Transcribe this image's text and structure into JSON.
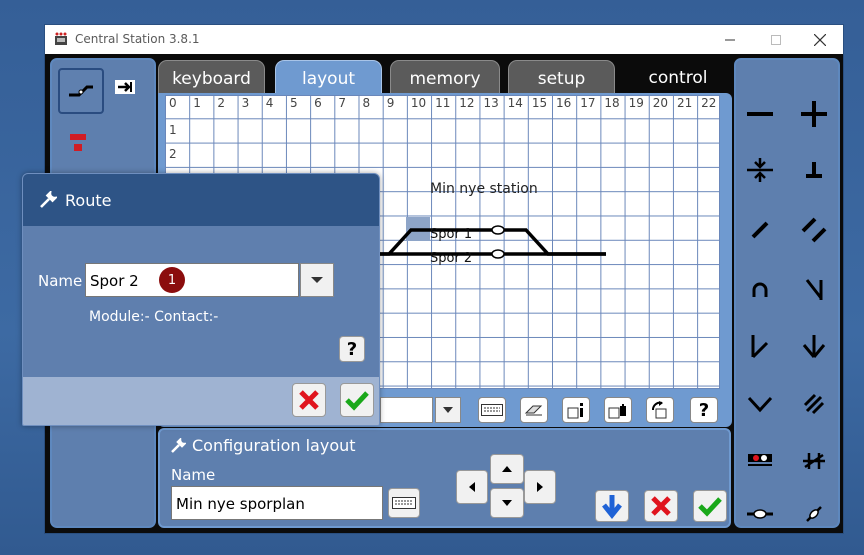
{
  "window": {
    "title": "Central Station 3.8.1"
  },
  "tabs": [
    {
      "label": "keyboard",
      "active": false
    },
    {
      "label": "layout",
      "active": true
    },
    {
      "label": "memory",
      "active": false
    },
    {
      "label": "setup",
      "active": false
    },
    {
      "label": "control",
      "active": false
    }
  ],
  "grid": {
    "columns": [
      "0",
      "1",
      "2",
      "3",
      "4",
      "5",
      "6",
      "7",
      "8",
      "9",
      "10",
      "11",
      "12",
      "13",
      "14",
      "15",
      "16",
      "17",
      "18",
      "19",
      "20",
      "21",
      "22"
    ],
    "rows": [
      "1",
      "2"
    ],
    "station_label": "Min nye station",
    "tracks": [
      "Spor 1",
      "Spor 2"
    ]
  },
  "config": {
    "title": "Configuration layout",
    "name_label": "Name",
    "name_value": "Min nye sporplan"
  },
  "route_dialog": {
    "title": "Route",
    "name_label": "Name",
    "name_value": "Spor 2",
    "badge": "1",
    "module_contact": "Module:- Contact:-",
    "help": "?"
  },
  "toolbar": {
    "help": "?"
  },
  "colors": {
    "background": "#3b67a0",
    "panel": "#5e7fae",
    "dialog_header": "#2e5486",
    "active_tab": "#6f9ad0",
    "badge": "#8b0d0d",
    "confirm_green": "#1aa81a",
    "cancel_red": "#e0141e",
    "arrow_blue": "#1f62d6"
  }
}
